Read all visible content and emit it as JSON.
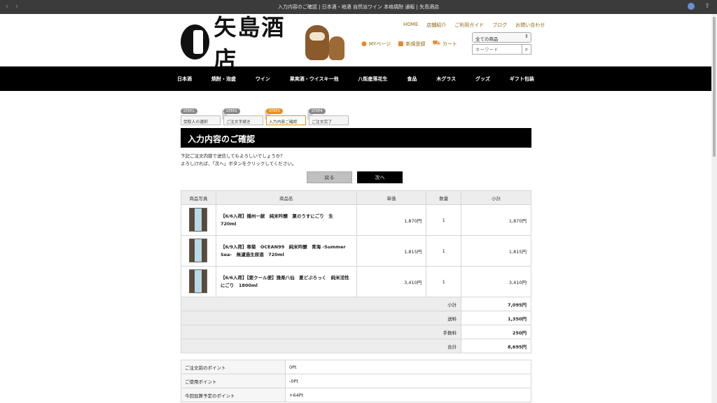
{
  "browser": {
    "title": "入力内容のご確認 | 日本酒・地酒 自然派ワイン 本格焼酎 通販 | 矢島酒店"
  },
  "header": {
    "brand": "矢島酒店",
    "top_links": [
      "HOME",
      "店舗紹介",
      "ご利用ガイド",
      "ブログ",
      "お問い合わせ"
    ],
    "user_links": [
      {
        "icon": "user-icon",
        "label": "MYページ"
      },
      {
        "icon": "register-icon",
        "label": "新規登録"
      },
      {
        "icon": "cart-icon",
        "label": "カート"
      }
    ],
    "search": {
      "category": "全ての商品",
      "placeholder": "キーワード"
    }
  },
  "nav": [
    "日本酒",
    "焼酎・泡盛",
    "ワイン",
    "果実酒・ウイスキー他",
    "八街産落花生",
    "食品",
    "木グラス",
    "グッズ",
    "ギフト包装"
  ],
  "steps": [
    {
      "badge": "STEP1",
      "label": "受取人の選択",
      "active": false
    },
    {
      "badge": "STEP2",
      "label": "ご注文手続き",
      "active": false
    },
    {
      "badge": "STEP3",
      "label": "入力内容ご確認",
      "active": true
    },
    {
      "badge": "STEP4",
      "label": "ご注文完了",
      "active": false
    }
  ],
  "page": {
    "title": "入力内容のご確認",
    "message_line1": "下記ご注文内容で送信してもよろしいでしょうか？",
    "message_line2": "よろしければ、「次へ」ボタンをクリックしてください。",
    "back_label": "戻る",
    "next_label": "次へ"
  },
  "cart": {
    "headers": [
      "商品写真",
      "商品名",
      "単価",
      "数量",
      "小計"
    ],
    "items": [
      {
        "name": "【6/6入荷】播州一献　純米吟醸　夏のうすにごり　生　720ml",
        "price": "1,870円",
        "qty": "1",
        "subtotal": "1,870円"
      },
      {
        "name": "【6/9入荷】寒菊　OCEAN99　純米吟醸　青海 -Summer Sea-　無濾過生原酒　720ml",
        "price": "1,815円",
        "qty": "1",
        "subtotal": "1,815円"
      },
      {
        "name": "【6/6入荷】【要クール便】雅楽八仙　夏どぶろっく　純米活性にごり　1800ml",
        "price": "3,410円",
        "qty": "1",
        "subtotal": "3,410円"
      }
    ],
    "summary": [
      {
        "label": "小計",
        "value": "7,095円"
      },
      {
        "label": "送料",
        "value": "1,350円"
      },
      {
        "label": "手数料",
        "value": "250円"
      },
      {
        "label": "合計",
        "value": "8,695円"
      }
    ]
  },
  "points": [
    {
      "label": "ご注文前のポイント",
      "value": "0Pt"
    },
    {
      "label": "ご使用ポイント",
      "value": "-0Pt"
    },
    {
      "label": "今回加算予定のポイント",
      "value": "+64Pt"
    }
  ]
}
